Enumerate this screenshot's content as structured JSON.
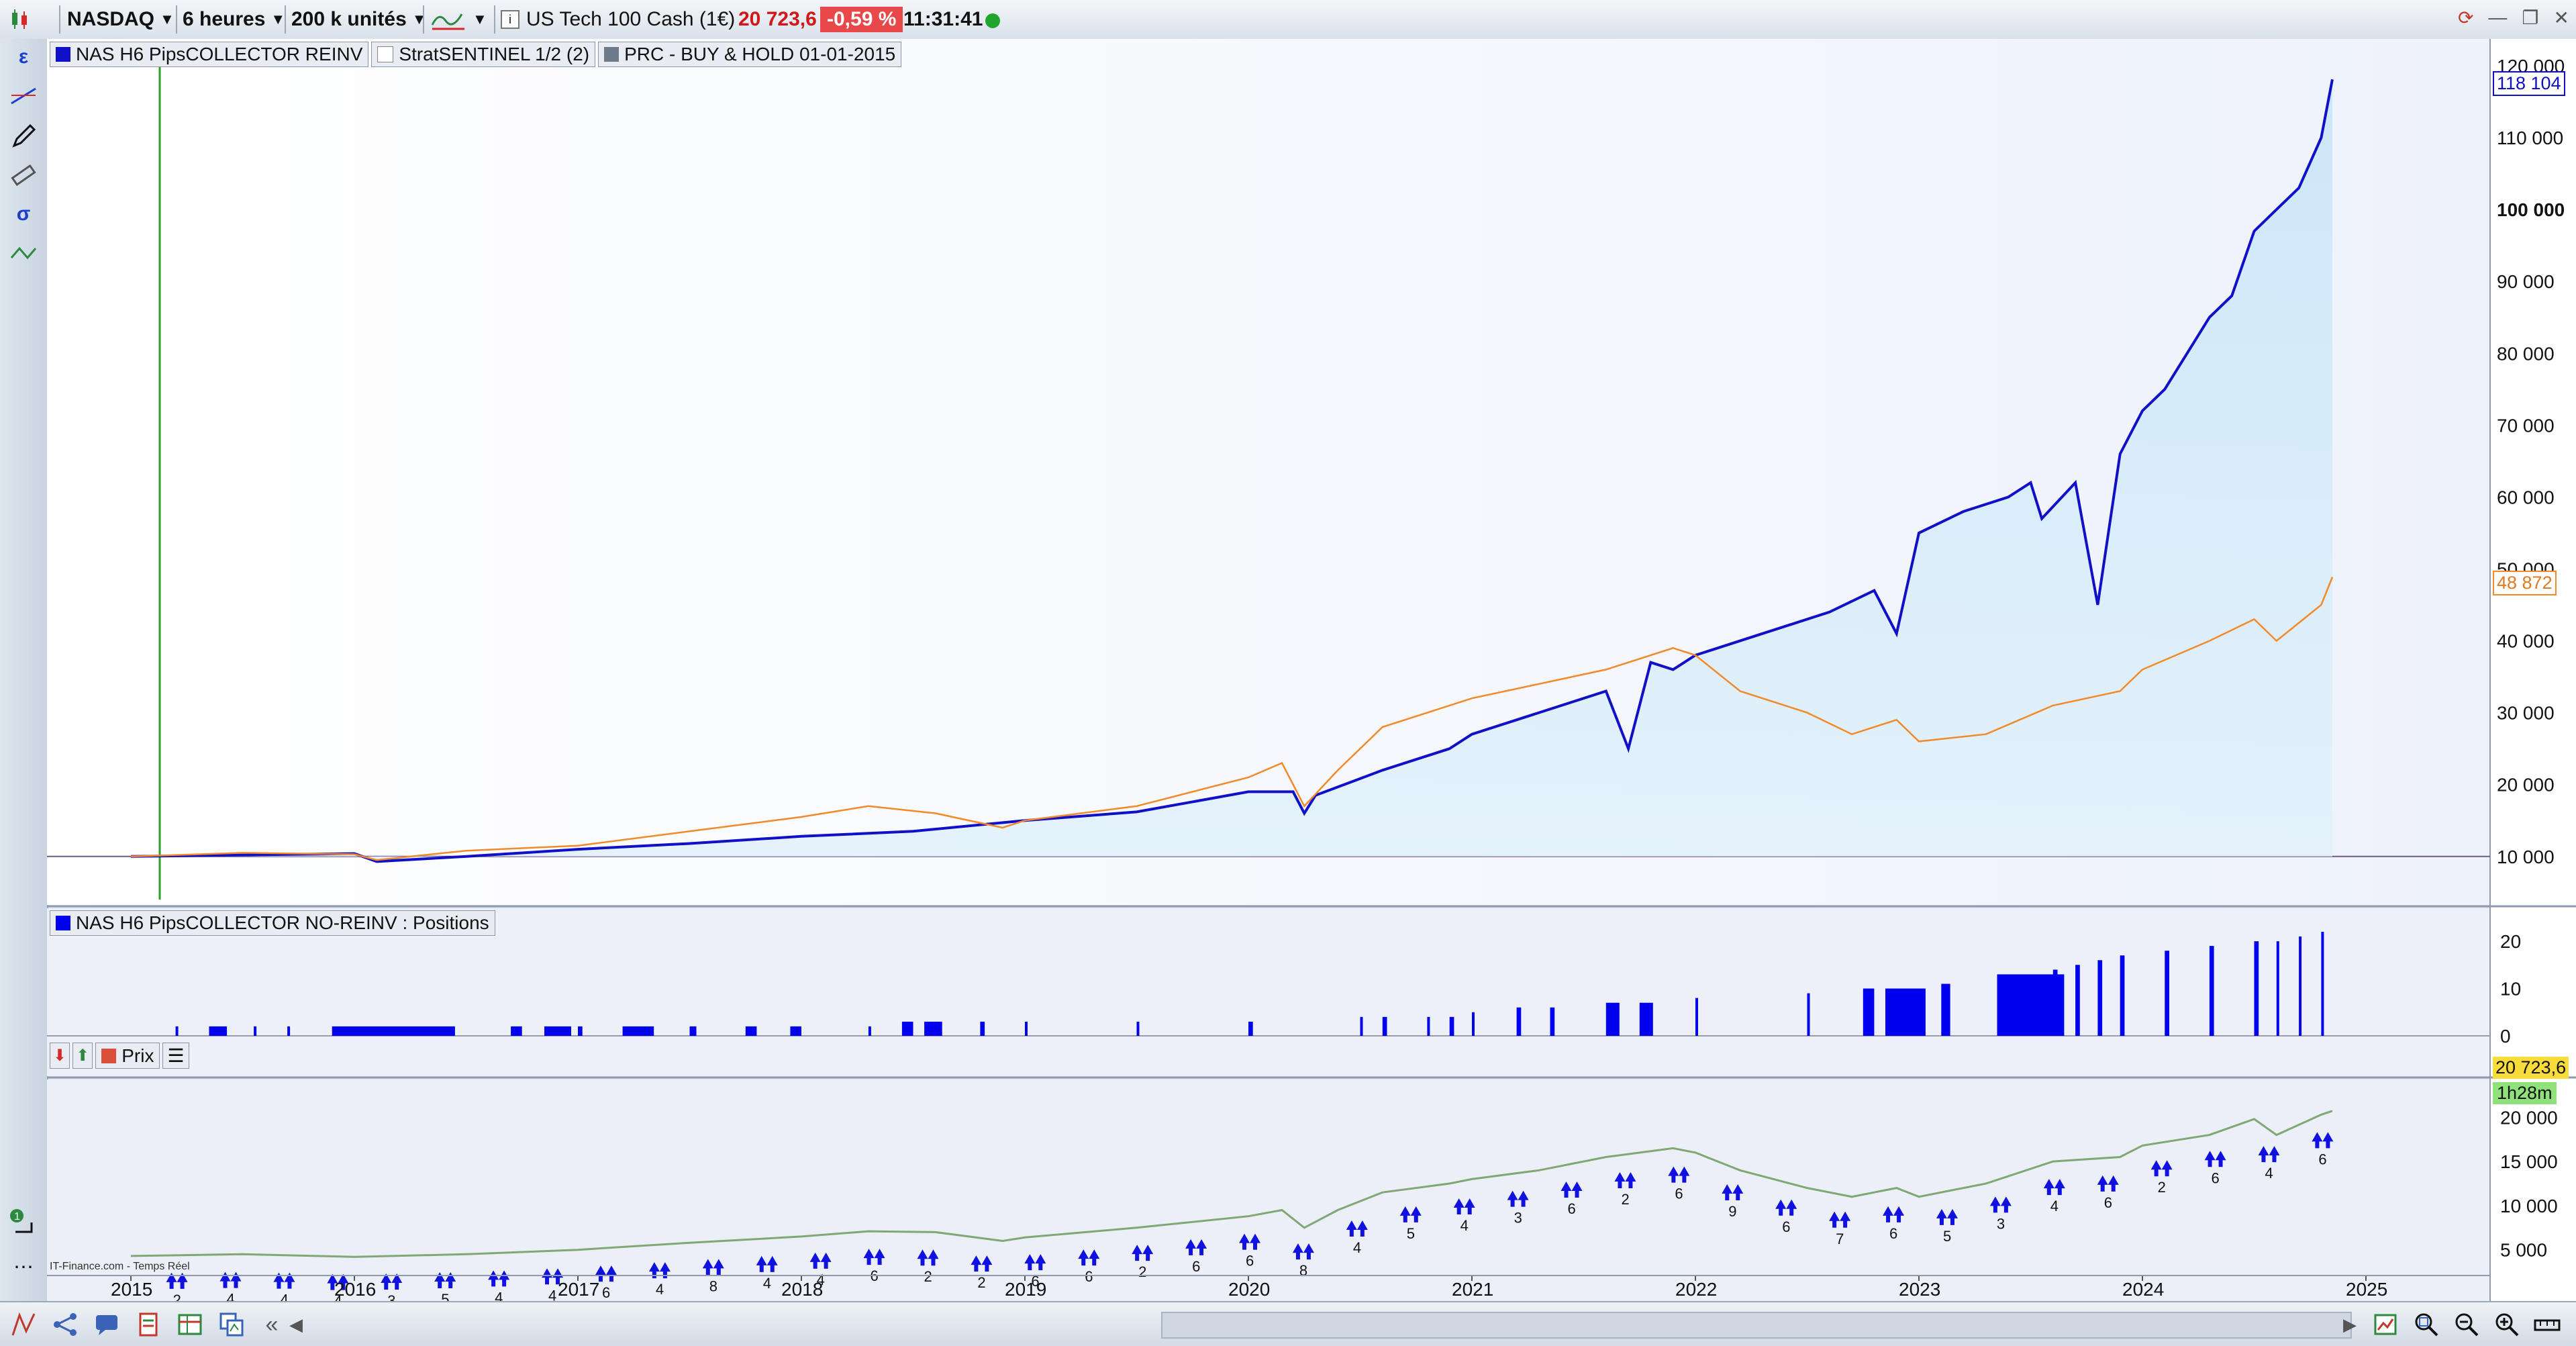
{
  "toolbar": {
    "market": "NASDAQ",
    "timeframe": "6 heures",
    "units": "200 k unités",
    "instrument": "US Tech 100 Cash (1€)",
    "price": "20 723,6",
    "change": "-0,59 %",
    "time": "11:31:41"
  },
  "panel1": {
    "legend": [
      "NAS H6 PipsCOLLECTOR REINV",
      "StratSENTINEL 1/2 (2)",
      "PRC - BUY & HOLD 01-01-2015"
    ],
    "last_blue_label": "118 104",
    "last_orange_label": "48 872"
  },
  "panel2": {
    "legend": "NAS H6 PipsCOLLECTOR NO-REINV : Positions"
  },
  "panel3": {
    "legend": "Prix",
    "price_label": "20 723,6",
    "countdown_label": "1h28m",
    "watermark": "IT-Finance.com - Temps Réel"
  },
  "chart_data": [
    {
      "type": "line",
      "title": "NAS H6 PipsCOLLECTOR REINV",
      "x_axis_years": [
        "2015",
        "2016",
        "2017",
        "2018",
        "2019",
        "2020",
        "2021",
        "2022",
        "2023",
        "2024",
        "2025"
      ],
      "y_ticks": [
        10000,
        20000,
        30000,
        40000,
        50000,
        60000,
        70000,
        80000,
        90000,
        100000,
        110000,
        120000
      ],
      "ylim": [
        4000,
        120000
      ],
      "series": [
        {
          "name": "NAS H6 PipsCOLLECTOR REINV",
          "color": "#1010c8",
          "points": [
            [
              2015.0,
              10000
            ],
            [
              2015.5,
              10200
            ],
            [
              2016.0,
              10400
            ],
            [
              2016.1,
              9300
            ],
            [
              2016.5,
              10000
            ],
            [
              2017.0,
              11000
            ],
            [
              2017.5,
              11800
            ],
            [
              2018.0,
              12800
            ],
            [
              2018.5,
              13500
            ],
            [
              2019.0,
              15000
            ],
            [
              2019.5,
              16200
            ],
            [
              2020.0,
              19000
            ],
            [
              2020.2,
              19000
            ],
            [
              2020.25,
              16000
            ],
            [
              2020.3,
              18500
            ],
            [
              2020.6,
              22000
            ],
            [
              2020.9,
              25000
            ],
            [
              2021.0,
              27000
            ],
            [
              2021.3,
              30000
            ],
            [
              2021.6,
              33000
            ],
            [
              2021.7,
              25000
            ],
            [
              2021.8,
              37000
            ],
            [
              2021.9,
              36000
            ],
            [
              2022.0,
              38000
            ],
            [
              2022.3,
              41000
            ],
            [
              2022.6,
              44000
            ],
            [
              2022.8,
              47000
            ],
            [
              2022.9,
              41000
            ],
            [
              2023.0,
              55000
            ],
            [
              2023.2,
              58000
            ],
            [
              2023.4,
              60000
            ],
            [
              2023.5,
              62000
            ],
            [
              2023.55,
              57000
            ],
            [
              2023.7,
              62000
            ],
            [
              2023.8,
              45000
            ],
            [
              2023.9,
              66000
            ],
            [
              2024.0,
              72000
            ],
            [
              2024.1,
              75000
            ],
            [
              2024.2,
              80000
            ],
            [
              2024.3,
              85000
            ],
            [
              2024.4,
              88000
            ],
            [
              2024.5,
              97000
            ],
            [
              2024.6,
              100000
            ],
            [
              2024.7,
              103000
            ],
            [
              2024.8,
              110000
            ],
            [
              2024.85,
              118104
            ]
          ]
        },
        {
          "name": "PRC - BUY & HOLD 01-01-2015",
          "color": "#f28a2a",
          "points": [
            [
              2015.0,
              10000
            ],
            [
              2015.5,
              10500
            ],
            [
              2016.0,
              10300
            ],
            [
              2016.1,
              9500
            ],
            [
              2016.5,
              10800
            ],
            [
              2017.0,
              11500
            ],
            [
              2017.5,
              13500
            ],
            [
              2018.0,
              15500
            ],
            [
              2018.3,
              17000
            ],
            [
              2018.6,
              16000
            ],
            [
              2018.9,
              14000
            ],
            [
              2019.0,
              15000
            ],
            [
              2019.5,
              17000
            ],
            [
              2020.0,
              21000
            ],
            [
              2020.15,
              23000
            ],
            [
              2020.25,
              17000
            ],
            [
              2020.4,
              22000
            ],
            [
              2020.6,
              28000
            ],
            [
              2020.9,
              31000
            ],
            [
              2021.0,
              32000
            ],
            [
              2021.3,
              34000
            ],
            [
              2021.6,
              36000
            ],
            [
              2021.9,
              39000
            ],
            [
              2022.0,
              38000
            ],
            [
              2022.2,
              33000
            ],
            [
              2022.5,
              30000
            ],
            [
              2022.7,
              27000
            ],
            [
              2022.9,
              29000
            ],
            [
              2023.0,
              26000
            ],
            [
              2023.3,
              27000
            ],
            [
              2023.6,
              31000
            ],
            [
              2023.9,
              33000
            ],
            [
              2024.0,
              36000
            ],
            [
              2024.3,
              40000
            ],
            [
              2024.5,
              43000
            ],
            [
              2024.6,
              40000
            ],
            [
              2024.8,
              45000
            ],
            [
              2024.85,
              48872
            ]
          ]
        }
      ]
    },
    {
      "type": "bar",
      "title": "NAS H6 PipsCOLLECTOR NO-REINV : Positions",
      "y_ticks": [
        0,
        10,
        20
      ],
      "ylim": [
        0,
        22
      ],
      "series": [
        {
          "name": "Positions",
          "color": "#0000ee",
          "bars": [
            [
              2015.2,
              2,
              0.01
            ],
            [
              2015.35,
              2,
              0.08
            ],
            [
              2015.55,
              2,
              0.01
            ],
            [
              2015.7,
              2,
              0.01
            ],
            [
              2015.9,
              2,
              0.55
            ],
            [
              2016.7,
              2,
              0.05
            ],
            [
              2016.85,
              2,
              0.12
            ],
            [
              2017.0,
              2,
              0.02
            ],
            [
              2017.2,
              2,
              0.14
            ],
            [
              2017.5,
              2,
              0.03
            ],
            [
              2017.75,
              2,
              0.05
            ],
            [
              2017.95,
              2,
              0.05
            ],
            [
              2018.3,
              2,
              0.01
            ],
            [
              2018.45,
              3,
              0.05
            ],
            [
              2018.55,
              3,
              0.08
            ],
            [
              2018.8,
              3,
              0.02
            ],
            [
              2019.0,
              3,
              0.01
            ],
            [
              2019.5,
              3,
              0.01
            ],
            [
              2020.0,
              3,
              0.02
            ],
            [
              2020.5,
              4,
              0.01
            ],
            [
              2020.6,
              4,
              0.02
            ],
            [
              2020.8,
              4,
              0.01
            ],
            [
              2020.9,
              4,
              0.02
            ],
            [
              2021.0,
              5,
              0.01
            ],
            [
              2021.2,
              6,
              0.02
            ],
            [
              2021.35,
              6,
              0.02
            ],
            [
              2021.6,
              7,
              0.06
            ],
            [
              2021.75,
              7,
              0.06
            ],
            [
              2022.0,
              8,
              0.01
            ],
            [
              2022.5,
              9,
              0.01
            ],
            [
              2022.75,
              10,
              0.05
            ],
            [
              2022.85,
              10,
              0.18
            ],
            [
              2023.1,
              11,
              0.04
            ],
            [
              2023.35,
              13,
              0.3
            ],
            [
              2023.6,
              14,
              0.02
            ],
            [
              2023.7,
              15,
              0.02
            ],
            [
              2023.8,
              16,
              0.02
            ],
            [
              2023.9,
              17,
              0.02
            ],
            [
              2024.1,
              18,
              0.02
            ],
            [
              2024.3,
              19,
              0.02
            ],
            [
              2024.5,
              20,
              0.02
            ],
            [
              2024.6,
              20,
              0.01
            ],
            [
              2024.7,
              21,
              0.01
            ],
            [
              2024.8,
              22,
              0.01
            ]
          ]
        }
      ]
    },
    {
      "type": "line",
      "title": "Prix",
      "y_ticks": [
        5000,
        10000,
        15000,
        20000
      ],
      "ylim": [
        3000,
        22000
      ],
      "series": [
        {
          "name": "Prix",
          "color": "#7fa874",
          "points": [
            [
              2015.0,
              4300
            ],
            [
              2015.5,
              4500
            ],
            [
              2016.0,
              4200
            ],
            [
              2016.5,
              4500
            ],
            [
              2017.0,
              5000
            ],
            [
              2017.5,
              5800
            ],
            [
              2018.0,
              6500
            ],
            [
              2018.3,
              7100
            ],
            [
              2018.6,
              7000
            ],
            [
              2018.9,
              6000
            ],
            [
              2019.0,
              6400
            ],
            [
              2019.5,
              7500
            ],
            [
              2020.0,
              8800
            ],
            [
              2020.15,
              9500
            ],
            [
              2020.25,
              7500
            ],
            [
              2020.4,
              9500
            ],
            [
              2020.6,
              11500
            ],
            [
              2020.9,
              12500
            ],
            [
              2021.0,
              13000
            ],
            [
              2021.3,
              14000
            ],
            [
              2021.6,
              15500
            ],
            [
              2021.9,
              16500
            ],
            [
              2022.0,
              16000
            ],
            [
              2022.2,
              14000
            ],
            [
              2022.5,
              12000
            ],
            [
              2022.7,
              11000
            ],
            [
              2022.9,
              12000
            ],
            [
              2023.0,
              11000
            ],
            [
              2023.3,
              12500
            ],
            [
              2023.6,
              15000
            ],
            [
              2023.9,
              15500
            ],
            [
              2024.0,
              16800
            ],
            [
              2024.3,
              18000
            ],
            [
              2024.5,
              19800
            ],
            [
              2024.6,
              18000
            ],
            [
              2024.8,
              20300
            ],
            [
              2024.85,
              20723.6
            ]
          ]
        }
      ],
      "signal_counts": [
        "2",
        "4",
        "4",
        "4",
        "3",
        "5",
        "4",
        "4",
        "6",
        "4",
        "8",
        "4",
        "4",
        "6",
        "2",
        "2",
        "6",
        "6",
        "2",
        "6",
        "6",
        "8",
        "4",
        "5",
        "4",
        "3",
        "6",
        "2",
        "6",
        "9",
        "6",
        "7",
        "6",
        "5",
        "3",
        "4",
        "6",
        "2",
        "6",
        "4",
        "6"
      ]
    }
  ]
}
